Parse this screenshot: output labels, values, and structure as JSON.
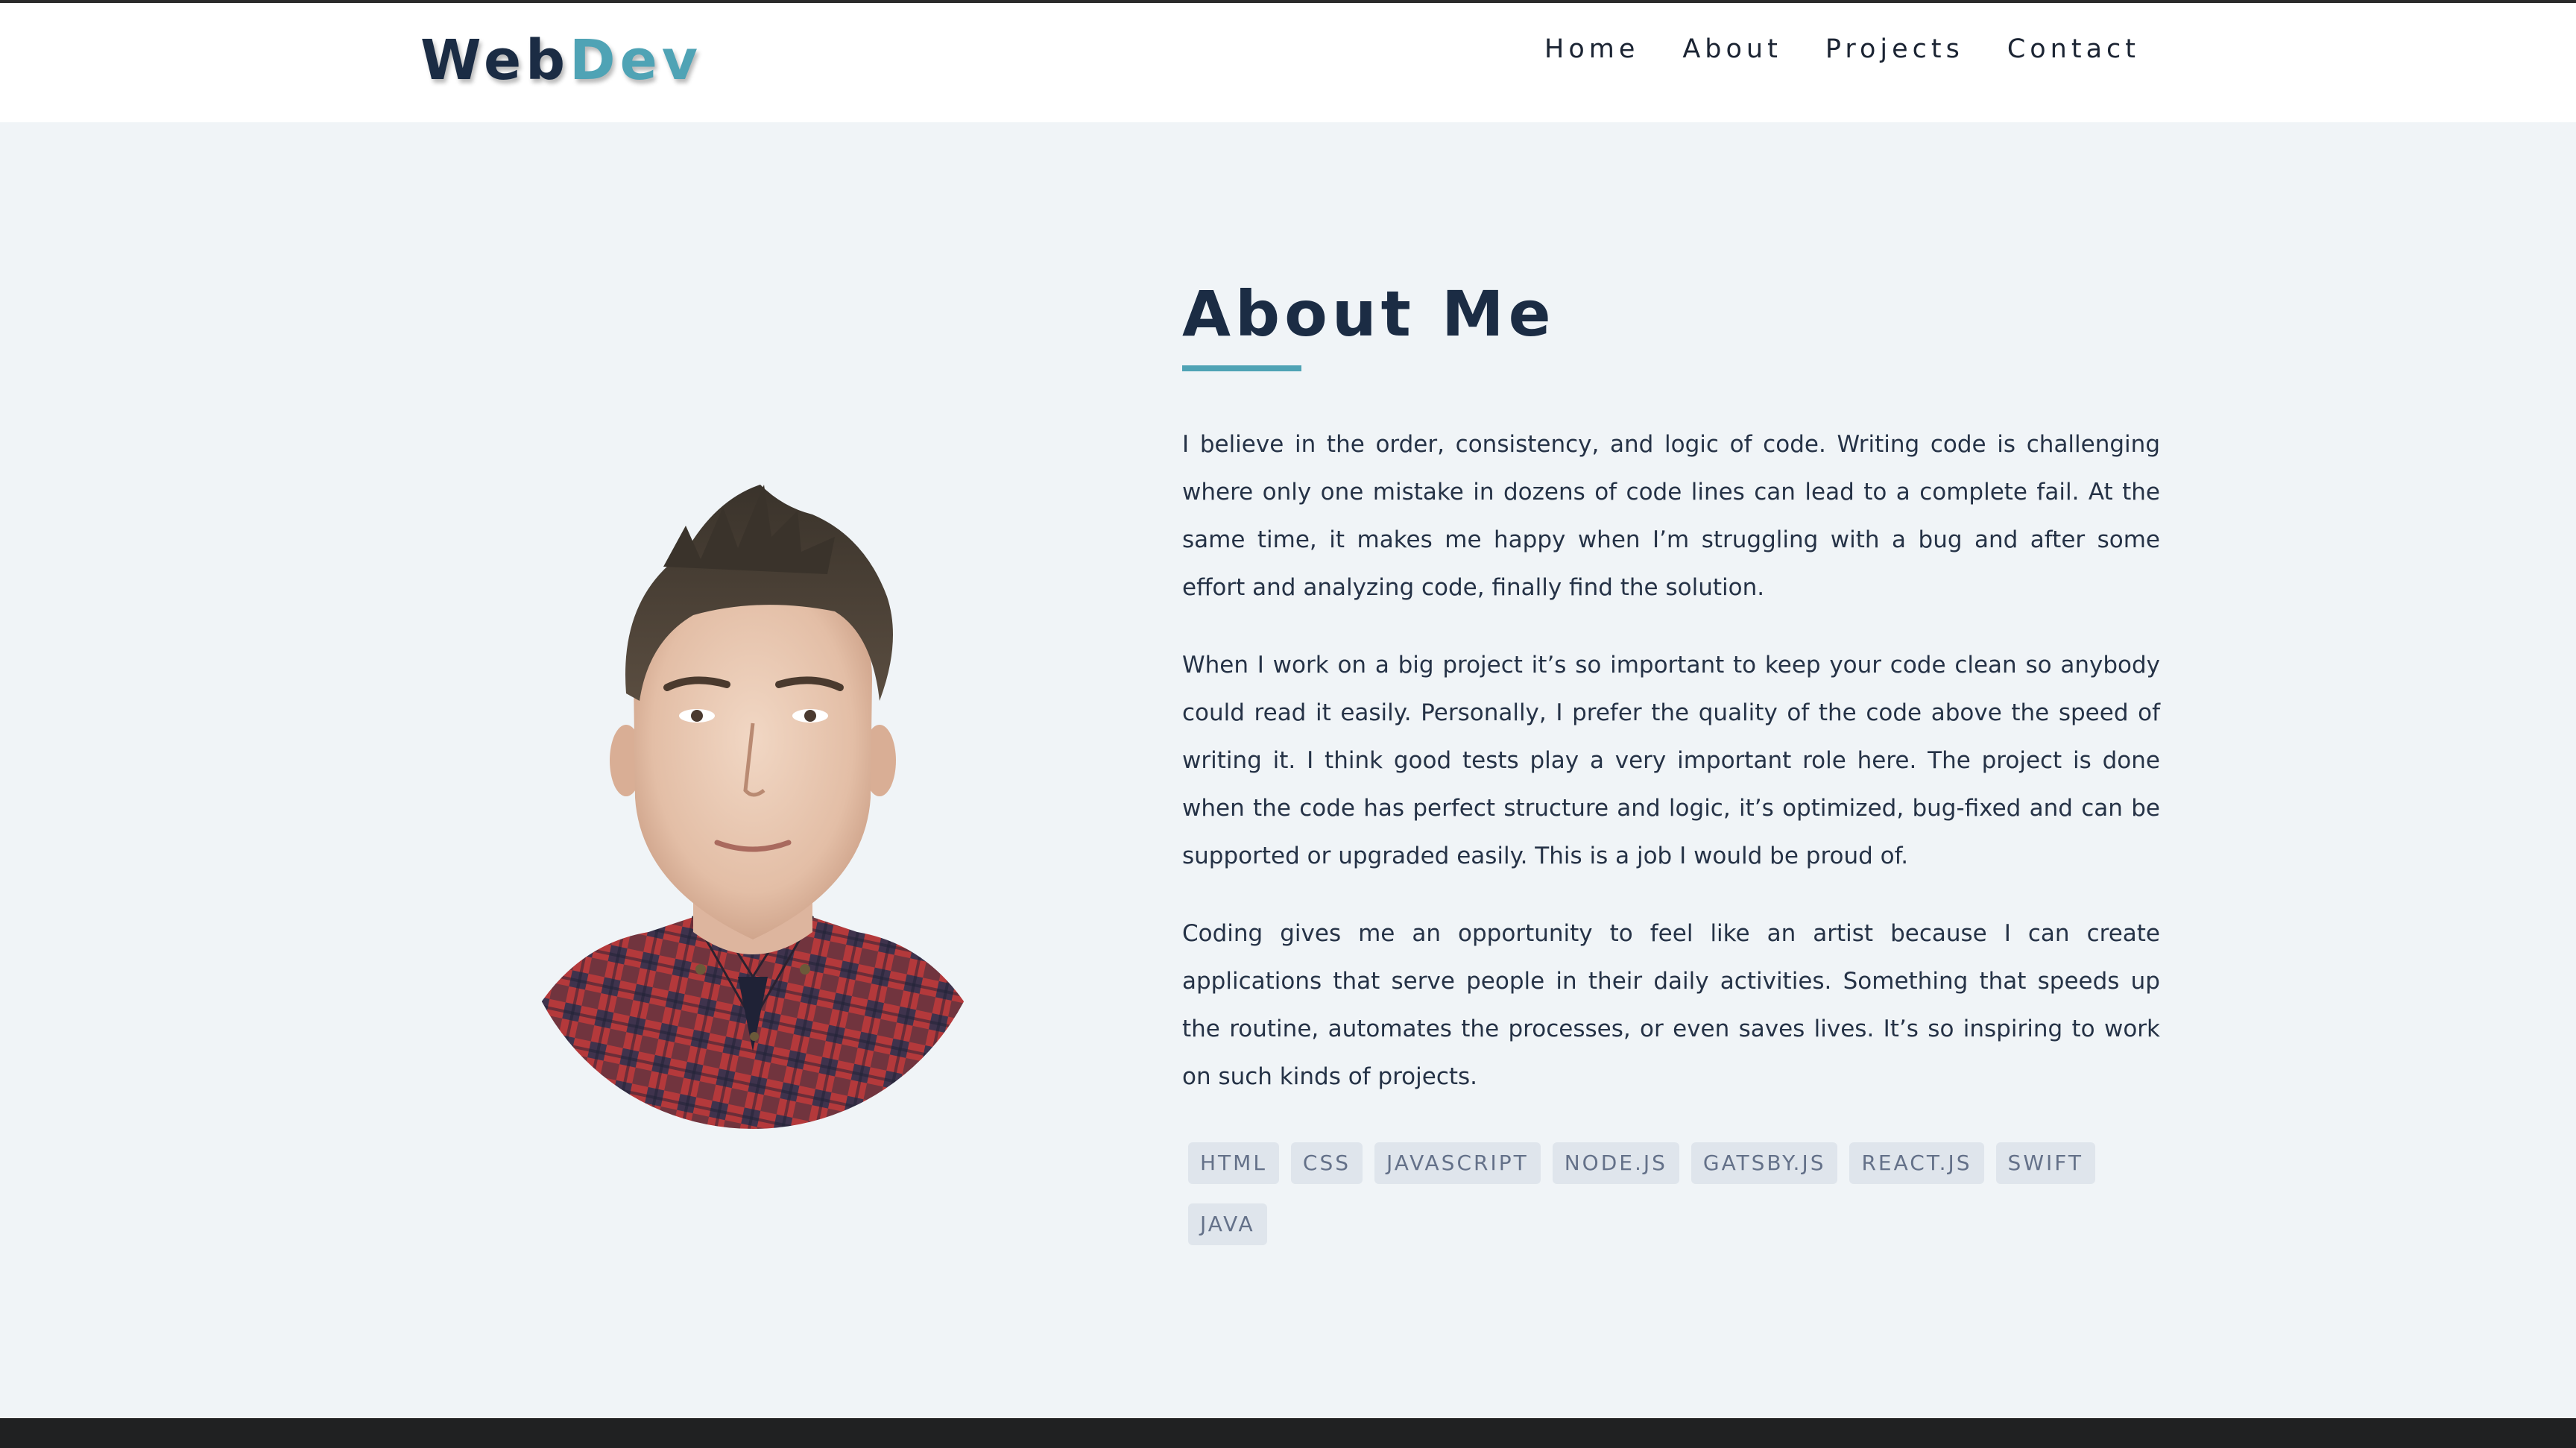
{
  "header": {
    "logo_part1": "Web",
    "logo_part2": "Dev",
    "nav": [
      "Home",
      "About",
      "Projects",
      "Contact"
    ]
  },
  "about": {
    "title": "About Me",
    "paragraphs": [
      "I believe in the order, consistency, and logic of code. Writing code is challenging where only one mistake in dozens of code lines can lead to a complete fail. At the same time, it makes me happy when I’m struggling with a bug and after some effort and analyzing code, finally find the solution.",
      "When I work on a big project it’s so important to keep your code clean so anybody could read it easily. Personally, I prefer the quality of the code above the speed of writing it. I think good tests play a very important role here. The project is done when the code has perfect structure and logic, it’s optimized, bug-fixed and can be supported or upgraded easily. This is a job I would be proud of.",
      "Coding gives me an opportunity to feel like an artist because I can create applications that serve people in their daily activities. Something that speeds up the routine, automates the processes, or even saves lives. It’s so inspiring to work on such kinds of projects."
    ],
    "skills": [
      "HTML",
      "CSS",
      "JAVASCRIPT",
      "NODE.JS",
      "GATSBY.JS",
      "REACT.JS",
      "SWIFT",
      "JAVA"
    ]
  },
  "colors": {
    "accent": "#4fa3b5",
    "navy": "#1b2c44",
    "background": "#f0f4f7",
    "tag_bg": "#dfe5ec",
    "footer": "#202122"
  }
}
